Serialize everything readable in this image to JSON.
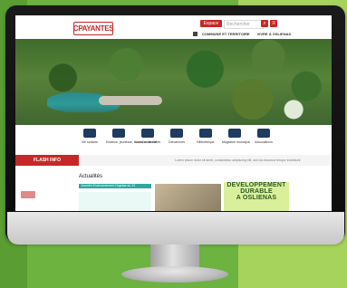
{
  "site": {
    "logo_text": "CPAYANTES",
    "top_button": "Espace citoyen",
    "search_placeholder": "Rechercher",
    "nav": [
      "COMMUNE ET TERRITOIRE",
      "VIVRE À OSLIENAS"
    ],
    "quick_links": [
      {
        "label": "Vie scolaire"
      },
      {
        "label": "Enfance, jeunesse, loisirs, solidarité"
      },
      {
        "label": "Location de salles"
      },
      {
        "label": "Démarches"
      },
      {
        "label": "Bibliothèque"
      },
      {
        "label": "Magazine municipal"
      },
      {
        "label": "Associations"
      }
    ],
    "flash_label": "FLASH INFO",
    "flash_text": "Lorem ipsum dolor sit amet, consectetur adipiscing elit, sed do eiusmod tempor incididunt",
    "news_title": "Actualités",
    "news_bar": "Journée Environnement Orgelas du 24",
    "dev_card": [
      "DEVELOPPEMENT",
      "DURABLE",
      "A OSLIENAS"
    ]
  }
}
